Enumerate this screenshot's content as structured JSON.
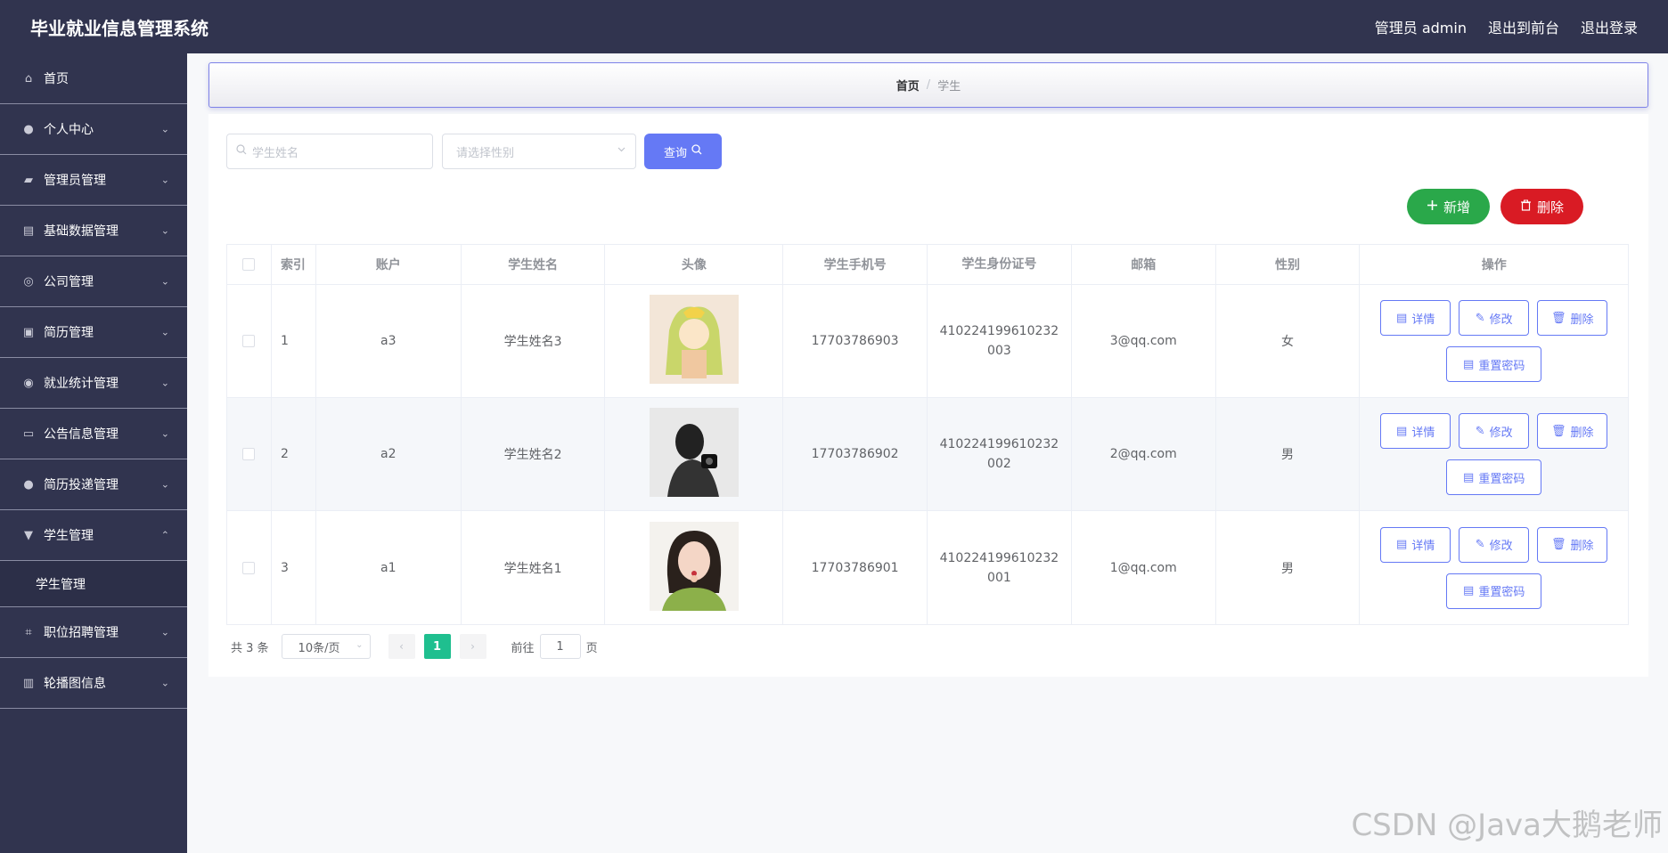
{
  "header": {
    "title": "毕业就业信息管理系统",
    "admin": "管理员 admin",
    "to_front": "退出到前台",
    "logout": "退出登录"
  },
  "sidebar": {
    "items": [
      {
        "label": "首页",
        "icon": "home-icon",
        "glyph": "⌂",
        "chevron": ""
      },
      {
        "label": "个人中心",
        "icon": "user-icon",
        "glyph": "●",
        "chevron": "⌄"
      },
      {
        "label": "管理员管理",
        "icon": "admin-icon",
        "glyph": "▰",
        "chevron": "⌄"
      },
      {
        "label": "基础数据管理",
        "icon": "data-icon",
        "glyph": "▤",
        "chevron": "⌄"
      },
      {
        "label": "公司管理",
        "icon": "compass-icon",
        "glyph": "◎",
        "chevron": "⌄"
      },
      {
        "label": "简历管理",
        "icon": "resume-icon",
        "glyph": "▣",
        "chevron": "⌄"
      },
      {
        "label": "就业统计管理",
        "icon": "stats-icon",
        "glyph": "◉",
        "chevron": "⌄"
      },
      {
        "label": "公告信息管理",
        "icon": "briefcase-icon",
        "glyph": "▭",
        "chevron": "⌄"
      },
      {
        "label": "简历投递管理",
        "icon": "send-icon",
        "glyph": "●",
        "chevron": "⌄"
      },
      {
        "label": "学生管理",
        "icon": "student-icon",
        "glyph": "▼",
        "chevron": "⌃"
      }
    ],
    "subitem": "学生管理",
    "after_items": [
      {
        "label": "职位招聘管理",
        "icon": "crop-icon",
        "glyph": "⌗",
        "chevron": "⌄"
      },
      {
        "label": "轮播图信息",
        "icon": "carousel-icon",
        "glyph": "▥",
        "chevron": "⌄"
      }
    ]
  },
  "breadcrumb": {
    "home": "首页",
    "separator": "/",
    "current": "学生"
  },
  "search": {
    "name_placeholder": "学生姓名",
    "gender_placeholder": "请选择性别",
    "query_label": "查询"
  },
  "actions": {
    "add_label": "新增",
    "delete_label": "删除"
  },
  "table": {
    "headers": [
      "索引",
      "账户",
      "学生姓名",
      "头像",
      "学生手机号",
      "学生身份证号",
      "邮箱",
      "性别",
      "操作"
    ],
    "rows": [
      {
        "index": "1",
        "account": "a3",
        "name": "学生姓名3",
        "phone": "17703786903",
        "id_number": "410224199610232003",
        "email": "3@qq.com",
        "gender": "女"
      },
      {
        "index": "2",
        "account": "a2",
        "name": "学生姓名2",
        "phone": "17703786902",
        "id_number": "410224199610232002",
        "email": "2@qq.com",
        "gender": "男"
      },
      {
        "index": "3",
        "account": "a1",
        "name": "学生姓名1",
        "phone": "17703786901",
        "id_number": "410224199610232001",
        "email": "1@qq.com",
        "gender": "男"
      }
    ],
    "op_labels": {
      "detail": "详情",
      "edit": "修改",
      "delete": "删除",
      "reset": "重置密码"
    }
  },
  "pagination": {
    "total": "共 3 条",
    "page_size": "10条/页",
    "current_page": "1",
    "goto_prefix": "前往",
    "goto_value": "1",
    "goto_suffix": "页"
  },
  "watermark": "CSDN @Java大鹅老师",
  "colors": {
    "header_bg": "#31344f",
    "primary": "#6579f5",
    "success": "#2aa84a",
    "danger": "#d91b24",
    "page_active": "#1fbf8f"
  }
}
